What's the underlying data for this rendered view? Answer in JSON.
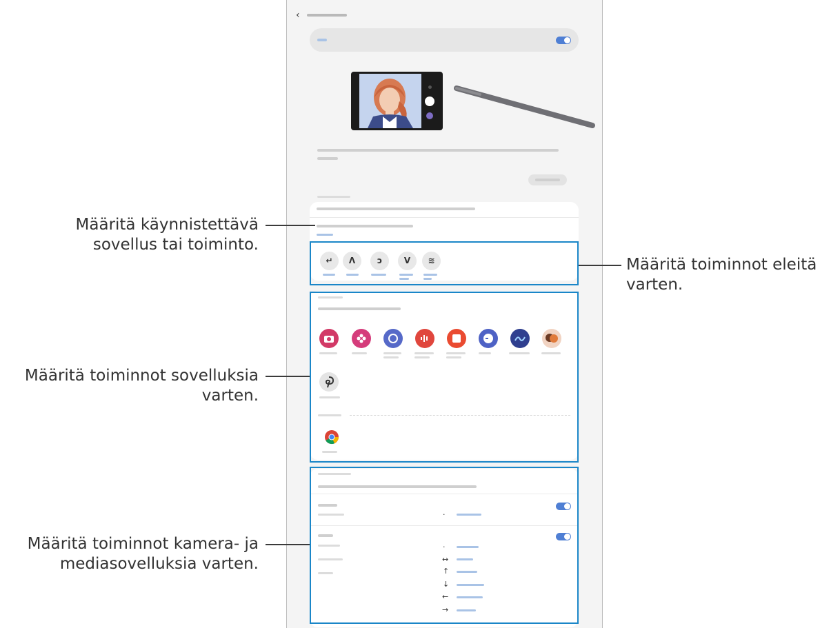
{
  "callouts": {
    "trigger": {
      "line1": "Määritä käynnistettävä",
      "line2": "sovellus tai toiminto."
    },
    "gestures": {
      "line1": "Määritä toiminnot eleitä",
      "line2": "varten."
    },
    "apps": {
      "line1": "Määritä toiminnot sovelluksia",
      "line2": "varten."
    },
    "media": {
      "line1": "Määritä toiminnot kamera- ja",
      "line2": "mediasovelluksia varten."
    }
  },
  "screen": {
    "back_glyph": "‹",
    "gesture_glyphs": [
      "↵",
      "Λ",
      "ↄ",
      "V",
      "≋"
    ],
    "arrow_glyphs": [
      "·",
      "↔",
      "↑",
      "↓",
      "←",
      "→"
    ],
    "single_press_glyph": "·"
  },
  "colors": {
    "highlight": "#1a86c8",
    "toggle_on": "#4f7fd4",
    "callout_line": "#3a3a3a"
  },
  "icons": {
    "apps_row1": [
      "camera-app-icon",
      "flower-app-icon",
      "internet-app-icon",
      "voice-recorder-app-icon",
      "notes-app-icon",
      "clock-app-icon",
      "penup-app-icon",
      "ar-emoji-app-icon"
    ],
    "apps_row2": [
      "drawing-app-icon"
    ],
    "apps_other": [
      "chrome-app-icon"
    ]
  }
}
